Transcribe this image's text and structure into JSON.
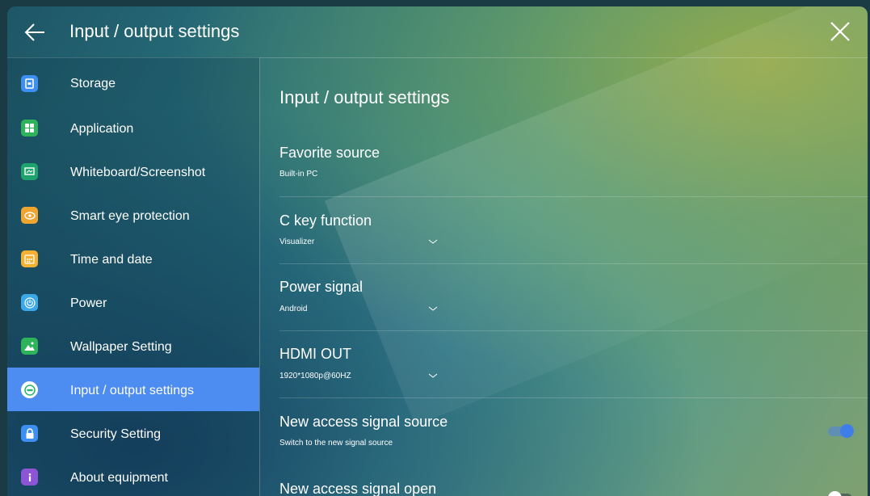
{
  "header": {
    "title": "Input / output settings"
  },
  "sidebar": {
    "items": [
      {
        "label": "Storage",
        "icon": "storage-icon",
        "color": "#3d8ff2"
      },
      {
        "label": "Application",
        "icon": "application-icon",
        "color": "#2fb35a"
      },
      {
        "label": "Whiteboard/Screenshot",
        "icon": "whiteboard-icon",
        "color": "#1fa36c"
      },
      {
        "label": "Smart eye protection",
        "icon": "eye-icon",
        "color": "#f1a531"
      },
      {
        "label": "Time and date",
        "icon": "calendar-icon",
        "color": "#f4b030"
      },
      {
        "label": "Power",
        "icon": "power-icon",
        "color": "#3ba8e8"
      },
      {
        "label": "Wallpaper Setting",
        "icon": "wallpaper-icon",
        "color": "#2fb35a"
      },
      {
        "label": "Input / output settings",
        "icon": "input-output-icon",
        "color": "#24b46b",
        "active": true
      },
      {
        "label": "Security Setting",
        "icon": "lock-icon",
        "color": "#3d8ff2"
      },
      {
        "label": "About equipment",
        "icon": "info-icon",
        "color": "#8c55d6"
      }
    ]
  },
  "main": {
    "title": "Input / output settings",
    "settings": [
      {
        "title": "Favorite source",
        "value": "Built-in PC"
      },
      {
        "title": "C key function",
        "value": "Visualizer",
        "dropdown": true
      },
      {
        "title": "Power signal",
        "value": "Android",
        "dropdown": true
      },
      {
        "title": "HDMI OUT",
        "value": "1920*1080p@60HZ",
        "dropdown": true
      },
      {
        "title": "New access signal source",
        "value": "Switch to the new signal source",
        "toggle_on": true
      },
      {
        "title": "New access signal open",
        "toggle_on": false
      }
    ]
  },
  "colors": {
    "accent": "#4d8cf0",
    "toggle_on": "#3f7ee8",
    "toggle_off": "#ffffff"
  }
}
